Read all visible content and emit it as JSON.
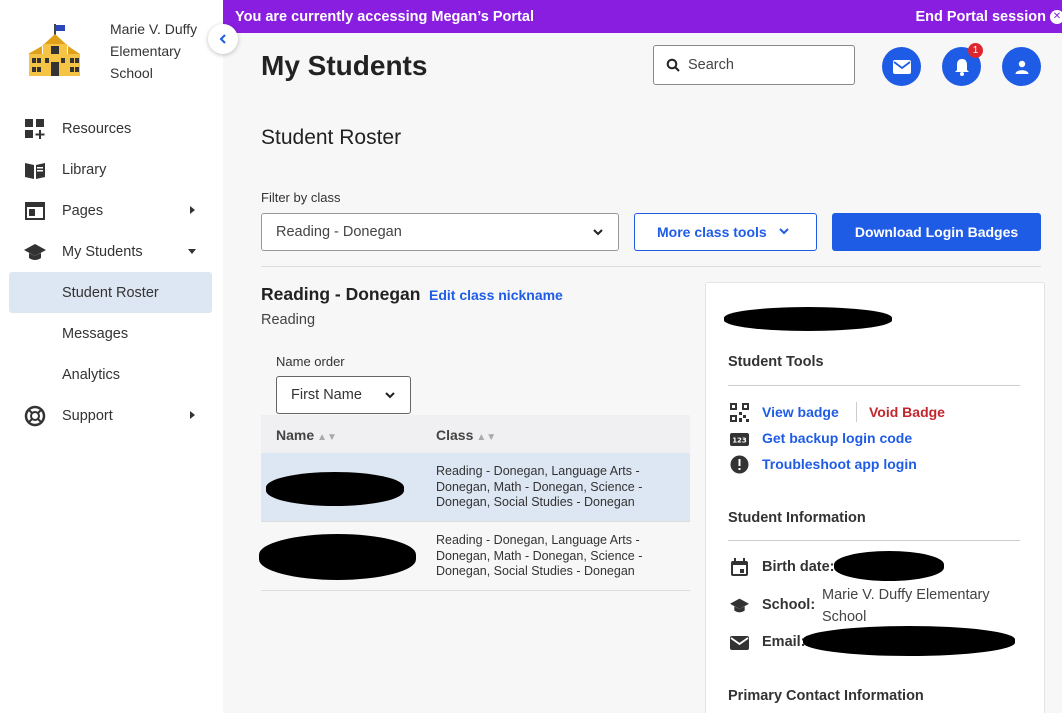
{
  "banner": {
    "message": "You are currently accessing Megan’s Portal",
    "end_label": "End Portal session"
  },
  "school": {
    "name": "Marie V. Duffy Elementary School"
  },
  "sidebar": {
    "items": [
      {
        "label": "Resources",
        "icon": "resources-icon"
      },
      {
        "label": "Library",
        "icon": "library-icon"
      },
      {
        "label": "Pages",
        "icon": "pages-icon"
      },
      {
        "label": "My Students",
        "icon": "graduation-cap-icon"
      },
      {
        "label": "Student Roster"
      },
      {
        "label": "Messages"
      },
      {
        "label": "Analytics"
      },
      {
        "label": "Support",
        "icon": "support-icon"
      }
    ]
  },
  "header": {
    "title": "My Students",
    "search_placeholder": "Search",
    "notification_count": "1"
  },
  "roster": {
    "title": "Student Roster",
    "filter_label": "Filter by class",
    "selected_class": "Reading - Donegan",
    "more_tools_label": "More class tools",
    "download_label": "Download Login Badges",
    "class_heading": "Reading - Donegan",
    "edit_nickname_label": "Edit class nickname",
    "class_subject": "Reading",
    "name_order_label": "Name order",
    "name_order_value": "First Name",
    "columns": {
      "name": "Name",
      "class": "Class"
    },
    "rows": [
      {
        "classes": "Reading - Donegan, Language Arts - Donegan, Math - Donegan, Science - Donegan, Social Studies - Donegan"
      },
      {
        "classes": "Reading - Donegan, Language Arts - Donegan, Math - Donegan, Science - Donegan, Social Studies - Donegan"
      }
    ]
  },
  "panel": {
    "student_tools_title": "Student Tools",
    "view_badge": "View badge",
    "void_badge": "Void Badge",
    "backup_code": "Get backup login code",
    "troubleshoot": "Troubleshoot app login",
    "student_info_title": "Student Information",
    "birth_label": "Birth date:",
    "school_label": "School:",
    "school_value": "Marie V. Duffy Elementary School",
    "email_label": "Email:",
    "primary_contact_title": "Primary Contact Information"
  },
  "colors": {
    "banner": "#8a1ee0",
    "accent": "#1f5ce6",
    "danger": "#c0262c",
    "selected_row": "#dde6f3"
  }
}
